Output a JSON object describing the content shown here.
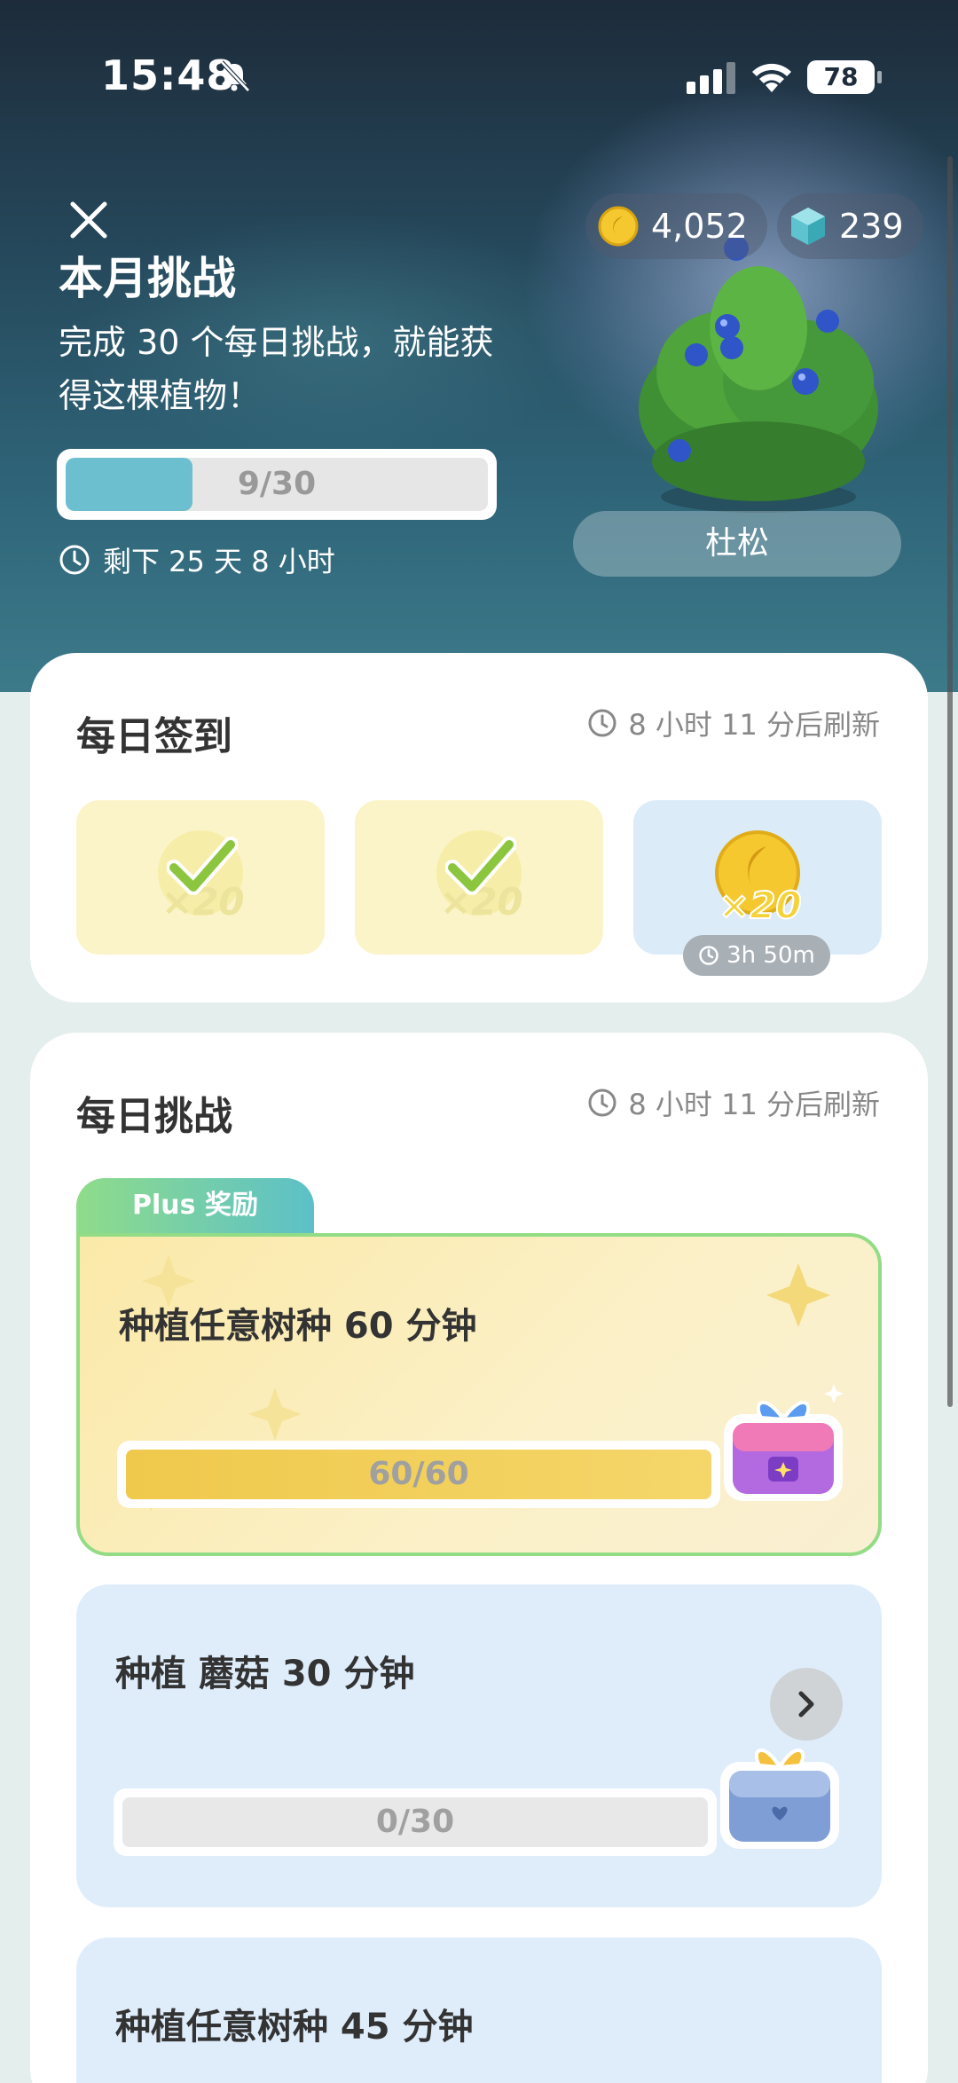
{
  "status_bar": {
    "time": "15:48",
    "battery": "78"
  },
  "header": {
    "title": "本月挑战",
    "subtitle": "完成 30 个每日挑战，就能获得这棵植物！",
    "progress_text": "9/30",
    "progress_fraction": 0.3,
    "remaining": "剩下 25 天 8 小时"
  },
  "currency": {
    "coins": "4,052",
    "gems": "239"
  },
  "plant": {
    "name": "杜松"
  },
  "daily_checkin": {
    "title": "每日签到",
    "refresh": "8 小时 11 分后刷新",
    "rewards": [
      {
        "label": "×20",
        "state": "claimed"
      },
      {
        "label": "×20",
        "state": "claimed"
      },
      {
        "label": "×20",
        "state": "next",
        "timer": "3h 50m"
      }
    ]
  },
  "daily_challenge": {
    "title": "每日挑战",
    "refresh": "8 小时 11 分后刷新",
    "plus_tab": "Plus 奖励",
    "items": [
      {
        "title": "种植任意树种 60 分钟",
        "progress": "60/60",
        "fraction": 1.0
      },
      {
        "title": "种植 蘑菇 30 分钟",
        "progress": "0/30",
        "fraction": 0.0
      },
      {
        "title": "种植任意树种 45 分钟"
      }
    ]
  },
  "colors": {
    "progress_teal": "#6bbfcf",
    "challenge_gold": "#efc94c",
    "plus_green": "#93dc86",
    "card_blue": "#dfedfb"
  }
}
